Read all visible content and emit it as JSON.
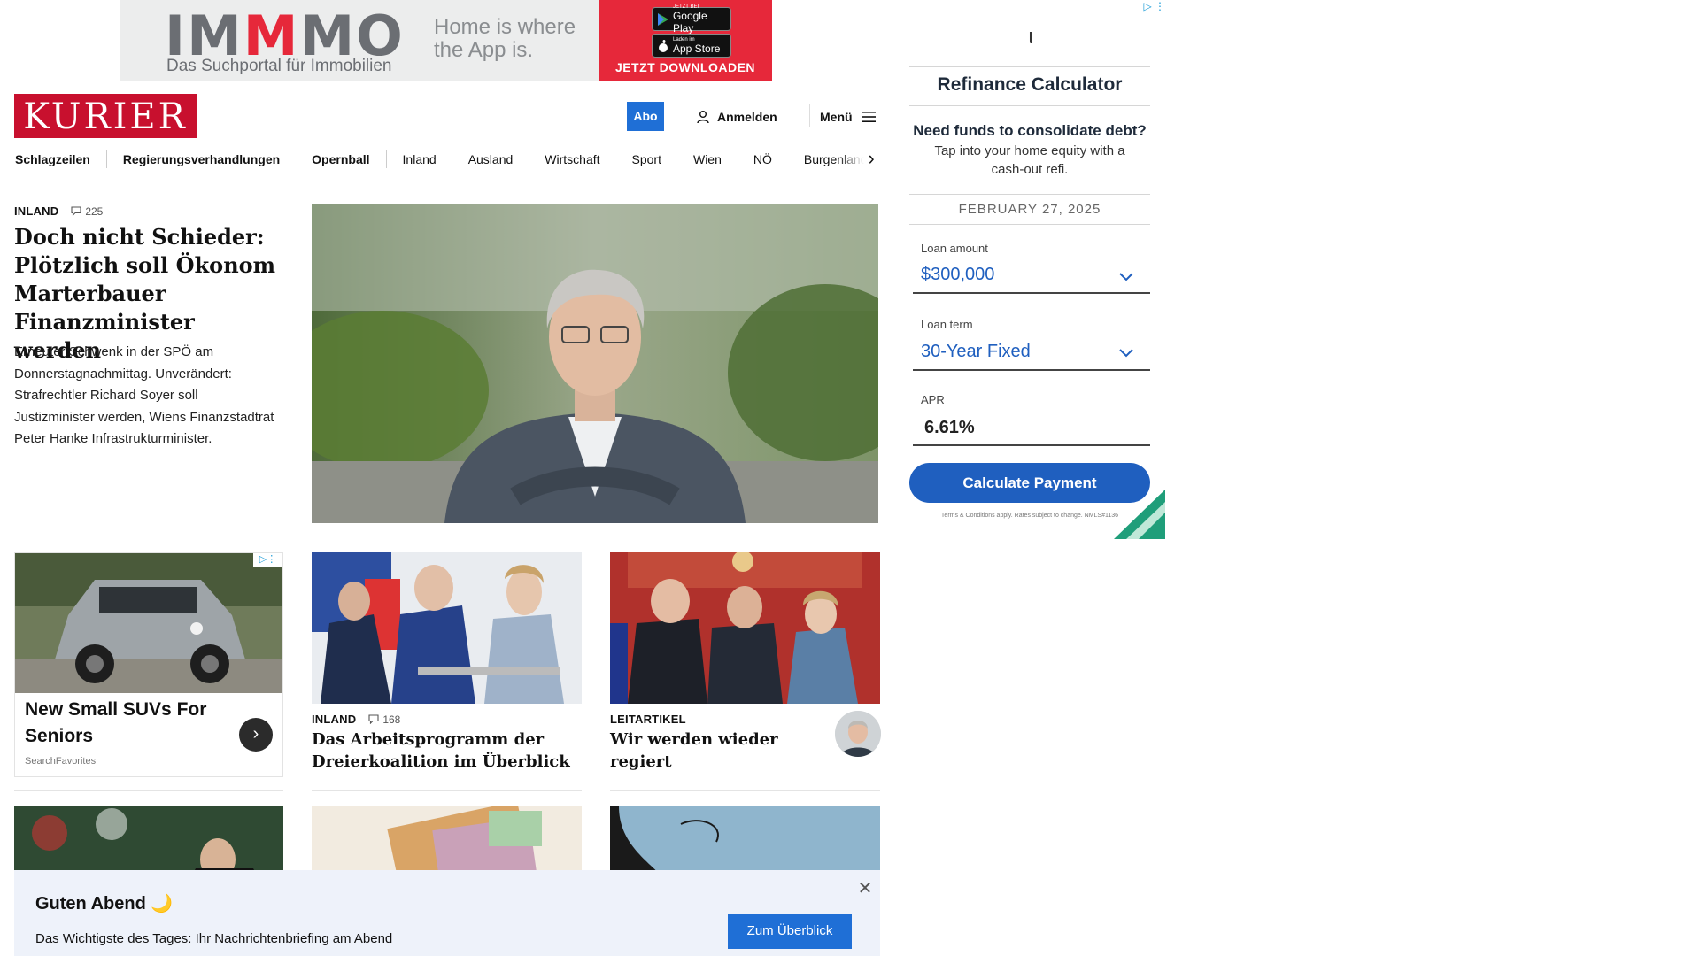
{
  "top_ad": {
    "logo_part1": "IM",
    "logo_part2": "M",
    "logo_part3": "MO",
    "logo_subline": "Das Suchportal für Immobilien",
    "tagline": "Home is where the App is.",
    "google_play_small": "JETZT BEI",
    "google_play": "Google Play",
    "app_store_small": "Laden im",
    "app_store": "App Store",
    "cta": "JETZT DOWNLOADEN",
    "brand_color": "#e6283a"
  },
  "header": {
    "logo": "KURIER",
    "logo_color": "#c8102e",
    "abo": "Abo",
    "login": "Anmelden",
    "menu": "Menü"
  },
  "nav": {
    "items": [
      {
        "label": "Schlagzeilen"
      },
      {
        "label": "Regierungsverhandlungen"
      },
      {
        "label": "Opernball"
      },
      {
        "label": "Inland"
      },
      {
        "label": "Ausland"
      },
      {
        "label": "Wirtschaft"
      },
      {
        "label": "Sport"
      },
      {
        "label": "Wien"
      },
      {
        "label": "NÖ"
      },
      {
        "label": "Burgenland"
      }
    ],
    "arrow": "›"
  },
  "lead": {
    "kicker": "INLAND",
    "comments": "225",
    "title": "Doch nicht Schieder: Plötzlich soll Ökonom Marterbauer Finanzminister werden",
    "teaser": "Erneuter Schwenk in der SPÖ am Donnerstagnachmittag. Unverändert: Strafrechtler Richard Soyer soll Justizminister werden, Wiens Finanzstadtrat Peter Hanke Infrastrukturminister."
  },
  "sponsored": {
    "title": "New Small SUVs For Seniors",
    "source": "SearchFavorites",
    "arrow": "›"
  },
  "card2": {
    "kicker": "INLAND",
    "comments": "168",
    "title": "Das Arbeitsprogramm der Dreierkoalition im Überblick"
  },
  "card3": {
    "kicker": "LEITARTIKEL",
    "title": "Wir werden wieder regiert"
  },
  "notification": {
    "title": "Guten Abend 🌙",
    "text": "Das Wichtigste des Tages: Ihr Nachrichtenbriefing am Abend",
    "button": "Zum Überblick",
    "close": "✕"
  },
  "side_ad": {
    "brand_mark": "ι",
    "title": "Refinance Calculator",
    "headline": "Need funds to consolidate debt?",
    "subline": "Tap into your home equity with a cash-out refi.",
    "date": "FEBRUARY 27, 2025",
    "loan_amount_label": "Loan amount",
    "loan_amount_value": "$300,000",
    "loan_term_label": "Loan term",
    "loan_term_value": "30-Year Fixed",
    "apr_label": "APR",
    "apr_value": "6.61%",
    "button": "Calculate Payment",
    "terms": "Terms & Conditions apply. Rates subject to change. NMLS#1136",
    "accent_color": "#1f5fbf"
  }
}
